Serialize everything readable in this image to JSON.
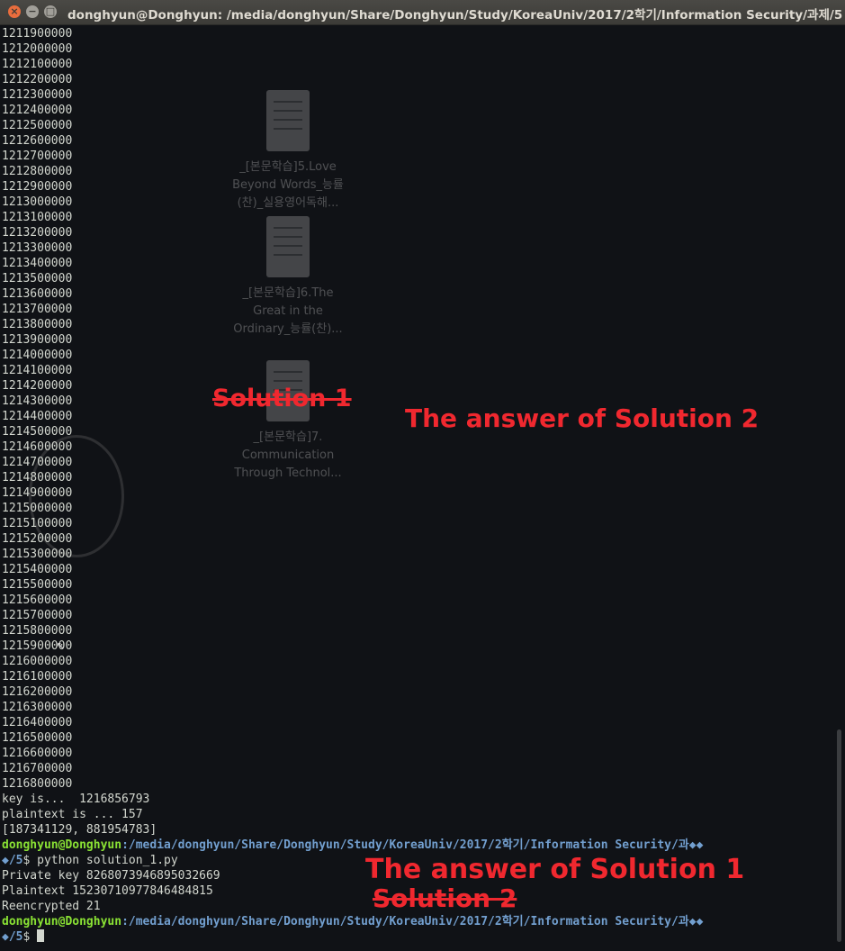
{
  "window": {
    "title": "donghyun@Donghyun: /media/donghyun/Share/Donghyun/Study/KoreaUniv/2017/2학기/Information Security/과제/5",
    "close_label": "×",
    "minimize_label": "−",
    "maximize_label": "□"
  },
  "terminal": {
    "counter_lines": [
      "1211900000",
      "1212000000",
      "1212100000",
      "1212200000",
      "1212300000",
      "1212400000",
      "1212500000",
      "1212600000",
      "1212700000",
      "1212800000",
      "1212900000",
      "1213000000",
      "1213100000",
      "1213200000",
      "1213300000",
      "1213400000",
      "1213500000",
      "1213600000",
      "1213700000",
      "1213800000",
      "1213900000",
      "1214000000",
      "1214100000",
      "1214200000",
      "1214300000",
      "1214400000",
      "1214500000",
      "1214600000",
      "1214700000",
      "1214800000",
      "1214900000",
      "1215000000",
      "1215100000",
      "1215200000",
      "1215300000",
      "1215400000",
      "1215500000",
      "1215600000",
      "1215700000",
      "1215800000",
      "1215900000",
      "1216000000",
      "1216100000",
      "1216200000",
      "1216300000",
      "1216400000",
      "1216500000",
      "1216600000",
      "1216700000",
      "1216800000"
    ],
    "key_line": "key is...  1216856793",
    "plaintext_line": "plaintext is ... 157",
    "pair_line": "[187341129, 881954783]",
    "prompt_user": "donghyun@Donghyun",
    "prompt_path_1": ":/media/donghyun/Share/Donghyun/Study/KoreaUniv/2017/2학기/Information Security/과◆◆",
    "prompt_path_2": "◆/5",
    "prompt_end_cmd": "$ python solution_1.py",
    "private_key_line": "Private key 8268073946895032669",
    "plaintext_out_line": "Plaintext 15230710977846484815",
    "reencrypted_line": "Reencrypted 21",
    "prompt_end": "$ "
  },
  "desktop_icons": [
    {
      "caption": "_[본문학습]5.Love Beyond Words_능률(찬)_실용영어독해..."
    },
    {
      "caption": "_[본문학습]6.The Great in the Ordinary_능률(찬)..."
    },
    {
      "caption": "_[본문학습]7. Communication Through Technol..."
    }
  ],
  "annotations": {
    "solution1_struck": "Solution 1",
    "answer2": "The answer of Solution 2",
    "answer1": "The answer of Solution 1",
    "solution2_struck": "Solution 2"
  }
}
